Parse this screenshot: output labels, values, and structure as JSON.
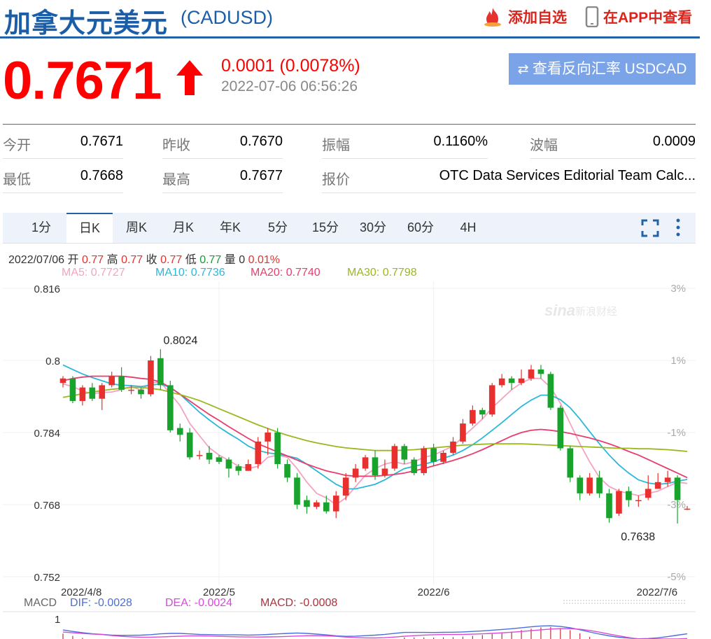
{
  "header": {
    "title": "加拿大元美元",
    "code": "(CADUSD)",
    "favorite_label": "添加自选",
    "app_label": "在APP中查看"
  },
  "quote": {
    "price": "0.7671",
    "change": "0.0001 (0.0078%)",
    "time": "2022-07-06 06:56:26",
    "reverse_button": "查看反向汇率 USDCAD"
  },
  "stats": [
    {
      "label": "今开",
      "value": "0.7671"
    },
    {
      "label": "昨收",
      "value": "0.7670"
    },
    {
      "label": "振幅",
      "value": "0.1160%"
    },
    {
      "label": "波幅",
      "value": "0.0009"
    },
    {
      "label": "最低",
      "value": "0.7668"
    },
    {
      "label": "最高",
      "value": "0.7677"
    },
    {
      "label": "报价",
      "value": "OTC Data Services Editorial Team Calc..."
    }
  ],
  "tabs": [
    "1分",
    "日K",
    "周K",
    "月K",
    "年K",
    "5分",
    "15分",
    "30分",
    "60分",
    "4H"
  ],
  "active_tab": "日K",
  "kline_info": {
    "date": "2022/07/06",
    "open_label": "开",
    "open": "0.77",
    "high_label": "高",
    "high": "0.77",
    "close_label": "收",
    "close": "0.77",
    "low_label": "低",
    "low": "0.77",
    "vol_label": "量",
    "vol": "0",
    "pct": "0.01%"
  },
  "ma": [
    {
      "label": "MA5: 0.7727",
      "color": "#f4a3c0"
    },
    {
      "label": "MA10: 0.7736",
      "color": "#2bb8d8"
    },
    {
      "label": "MA20: 0.7740",
      "color": "#e83e6e"
    },
    {
      "label": "MA30: 0.7798",
      "color": "#9ab81e"
    }
  ],
  "macd": {
    "title": "MACD",
    "dif": "DIF: -0.0028",
    "dea": "DEA: -0.0024",
    "macd": "MACD: -0.0008",
    "axis_top": "1"
  },
  "colors": {
    "up": "#e8312e",
    "down": "#17a32c",
    "brand": "#1b5ea7",
    "price": "#ff0000"
  },
  "chart_data": {
    "type": "candlestick",
    "ylim": [
      0.752,
      0.816
    ],
    "y_ticks": [
      "0.816",
      "0.8",
      "0.784",
      "0.768",
      "0.752"
    ],
    "pct_ticks": [
      "3%",
      "1%",
      "-1%",
      "-3%",
      "-5%"
    ],
    "x_labels": [
      {
        "label": "2022/4/8",
        "index": 0
      },
      {
        "label": "2022/5",
        "index": 16
      },
      {
        "label": "2022/6",
        "index": 38
      },
      {
        "label": "2022/7/6",
        "index": 63
      }
    ],
    "annotations": [
      {
        "label": "0.8024",
        "index": 9,
        "value": 0.8024
      },
      {
        "label": "0.7638",
        "index": 62,
        "value": 0.7638
      }
    ],
    "candles": [
      [
        0.795,
        0.796,
        0.794,
        0.7965
      ],
      [
        0.796,
        0.791,
        0.7905,
        0.7965
      ],
      [
        0.791,
        0.794,
        0.79,
        0.7945
      ],
      [
        0.794,
        0.7915,
        0.791,
        0.795
      ],
      [
        0.7915,
        0.7945,
        0.789,
        0.795
      ],
      [
        0.7945,
        0.7965,
        0.794,
        0.7975
      ],
      [
        0.7965,
        0.7935,
        0.793,
        0.7985
      ],
      [
        0.7935,
        0.7935,
        0.7925,
        0.7945
      ],
      [
        0.7935,
        0.7925,
        0.7915,
        0.794
      ],
      [
        0.7925,
        0.8,
        0.792,
        0.801
      ],
      [
        0.8005,
        0.7945,
        0.7935,
        0.8025
      ],
      [
        0.7945,
        0.7845,
        0.784,
        0.7955
      ],
      [
        0.785,
        0.7835,
        0.782,
        0.786
      ],
      [
        0.784,
        0.7785,
        0.778,
        0.785
      ],
      [
        0.779,
        0.779,
        0.778,
        0.78
      ],
      [
        0.7795,
        0.778,
        0.777,
        0.781
      ],
      [
        0.7785,
        0.7775,
        0.777,
        0.779
      ],
      [
        0.778,
        0.776,
        0.774,
        0.7785
      ],
      [
        0.7765,
        0.7755,
        0.7745,
        0.777
      ],
      [
        0.7755,
        0.777,
        0.7755,
        0.778
      ],
      [
        0.777,
        0.782,
        0.776,
        0.783
      ],
      [
        0.782,
        0.784,
        0.779,
        0.785
      ],
      [
        0.784,
        0.777,
        0.776,
        0.785
      ],
      [
        0.777,
        0.774,
        0.773,
        0.778
      ],
      [
        0.774,
        0.768,
        0.767,
        0.775
      ],
      [
        0.769,
        0.7675,
        0.766,
        0.77
      ],
      [
        0.7675,
        0.7685,
        0.767,
        0.769
      ],
      [
        0.7685,
        0.7665,
        0.766,
        0.77
      ],
      [
        0.7665,
        0.77,
        0.765,
        0.771
      ],
      [
        0.77,
        0.774,
        0.769,
        0.775
      ],
      [
        0.774,
        0.776,
        0.773,
        0.777
      ],
      [
        0.776,
        0.7785,
        0.7755,
        0.779
      ],
      [
        0.7785,
        0.7745,
        0.7735,
        0.78
      ],
      [
        0.7745,
        0.776,
        0.774,
        0.778
      ],
      [
        0.776,
        0.781,
        0.7755,
        0.7815
      ],
      [
        0.781,
        0.778,
        0.777,
        0.7815
      ],
      [
        0.778,
        0.775,
        0.7745,
        0.7785
      ],
      [
        0.775,
        0.7805,
        0.7745,
        0.781
      ],
      [
        0.7805,
        0.7775,
        0.7765,
        0.7815
      ],
      [
        0.7775,
        0.7795,
        0.777,
        0.78
      ],
      [
        0.7795,
        0.782,
        0.779,
        0.783
      ],
      [
        0.782,
        0.786,
        0.7815,
        0.787
      ],
      [
        0.786,
        0.789,
        0.7855,
        0.79
      ],
      [
        0.789,
        0.788,
        0.787,
        0.7895
      ],
      [
        0.788,
        0.7945,
        0.7875,
        0.795
      ],
      [
        0.7945,
        0.796,
        0.794,
        0.797
      ],
      [
        0.796,
        0.795,
        0.7935,
        0.7965
      ],
      [
        0.795,
        0.796,
        0.7945,
        0.798
      ],
      [
        0.796,
        0.798,
        0.7955,
        0.799
      ],
      [
        0.798,
        0.797,
        0.796,
        0.799
      ],
      [
        0.797,
        0.7895,
        0.789,
        0.7975
      ],
      [
        0.7895,
        0.7805,
        0.78,
        0.79
      ],
      [
        0.7805,
        0.774,
        0.773,
        0.781
      ],
      [
        0.774,
        0.7705,
        0.769,
        0.7745
      ],
      [
        0.7705,
        0.774,
        0.77,
        0.775
      ],
      [
        0.774,
        0.7705,
        0.7695,
        0.7755
      ],
      [
        0.7705,
        0.765,
        0.764,
        0.7715
      ],
      [
        0.766,
        0.771,
        0.7655,
        0.7715
      ],
      [
        0.771,
        0.769,
        0.7675,
        0.772
      ],
      [
        0.769,
        0.769,
        0.7675,
        0.77
      ],
      [
        0.7695,
        0.7715,
        0.769,
        0.7745
      ],
      [
        0.7715,
        0.773,
        0.7715,
        0.775
      ],
      [
        0.773,
        0.774,
        0.772,
        0.7755
      ],
      [
        0.774,
        0.769,
        0.7638,
        0.7745
      ],
      [
        0.7671,
        0.7671,
        0.7668,
        0.7677
      ]
    ],
    "ma_series": [
      {
        "name": "MA5",
        "values": [
          0.7948,
          0.7942,
          0.7932,
          0.7926,
          0.7929,
          0.793,
          0.7935,
          0.7942,
          0.7934,
          0.795,
          0.7952,
          0.7926,
          0.79,
          0.786,
          0.7833,
          0.7806,
          0.779,
          0.7778,
          0.7765,
          0.776,
          0.7765,
          0.7785,
          0.779,
          0.7785,
          0.776,
          0.773,
          0.7705,
          0.7695,
          0.768,
          0.7695,
          0.772,
          0.7745,
          0.776,
          0.777,
          0.7775,
          0.777,
          0.7775,
          0.7785,
          0.779,
          0.78,
          0.781,
          0.783,
          0.785,
          0.787,
          0.7895,
          0.7915,
          0.7935,
          0.795,
          0.796,
          0.796,
          0.794,
          0.7905,
          0.786,
          0.7815,
          0.7775,
          0.774,
          0.772,
          0.771,
          0.7705,
          0.77,
          0.7705,
          0.771,
          0.772,
          0.773,
          0.7727
        ]
      },
      {
        "name": "MA10",
        "values": [
          0.799,
          0.798,
          0.797,
          0.7962,
          0.7955,
          0.7948,
          0.7945,
          0.7944,
          0.7942,
          0.7945,
          0.7948,
          0.794,
          0.7925,
          0.7905,
          0.7885,
          0.7868,
          0.7852,
          0.7838,
          0.7825,
          0.781,
          0.78,
          0.7795,
          0.7792,
          0.7788,
          0.7783,
          0.777,
          0.7755,
          0.774,
          0.7725,
          0.7715,
          0.7715,
          0.772,
          0.7725,
          0.7735,
          0.7748,
          0.776,
          0.7765,
          0.777,
          0.7775,
          0.7783,
          0.779,
          0.78,
          0.7813,
          0.7828,
          0.7845,
          0.7862,
          0.788,
          0.7898,
          0.7912,
          0.7923,
          0.7923,
          0.7913,
          0.7895,
          0.787,
          0.7842,
          0.7815,
          0.779,
          0.7768,
          0.775,
          0.7735,
          0.7728,
          0.7725,
          0.7727,
          0.7732,
          0.7736
        ]
      },
      {
        "name": "MA20",
        "values": [
          0.7955,
          0.796,
          0.7963,
          0.7965,
          0.7965,
          0.7965,
          0.7965,
          0.7963,
          0.796,
          0.7958,
          0.7952,
          0.794,
          0.7925,
          0.791,
          0.7895,
          0.788,
          0.7867,
          0.7853,
          0.784,
          0.7827,
          0.7815,
          0.7806,
          0.7797,
          0.7788,
          0.7779,
          0.777,
          0.7762,
          0.7755,
          0.775,
          0.7745,
          0.7743,
          0.7743,
          0.7743,
          0.7745,
          0.7747,
          0.775,
          0.7755,
          0.776,
          0.7766,
          0.7772,
          0.7778,
          0.7785,
          0.7793,
          0.7802,
          0.7812,
          0.7822,
          0.7832,
          0.784,
          0.7845,
          0.7847,
          0.7845,
          0.7842,
          0.7838,
          0.7833,
          0.7828,
          0.7822,
          0.7815,
          0.7807,
          0.7798,
          0.779,
          0.778,
          0.777,
          0.776,
          0.775,
          0.774
        ]
      },
      {
        "name": "MA30",
        "values": [
          0.7918,
          0.7922,
          0.7926,
          0.793,
          0.7933,
          0.7936,
          0.7938,
          0.794,
          0.794,
          0.7938,
          0.7935,
          0.793,
          0.7924,
          0.7918,
          0.7911,
          0.7902,
          0.7893,
          0.7884,
          0.7875,
          0.7866,
          0.7857,
          0.7849,
          0.7841,
          0.7834,
          0.7828,
          0.7822,
          0.7817,
          0.7813,
          0.7809,
          0.7806,
          0.7804,
          0.7802,
          0.78,
          0.78,
          0.78,
          0.7801,
          0.7802,
          0.7804,
          0.7806,
          0.7808,
          0.781,
          0.7812,
          0.7813,
          0.7814,
          0.7815,
          0.7815,
          0.7815,
          0.7815,
          0.7814,
          0.7813,
          0.7812,
          0.7811,
          0.781,
          0.7809,
          0.7808,
          0.7807,
          0.7806,
          0.7805,
          0.7805,
          0.7804,
          0.7804,
          0.7803,
          0.7802,
          0.78,
          0.7798
        ]
      }
    ]
  }
}
